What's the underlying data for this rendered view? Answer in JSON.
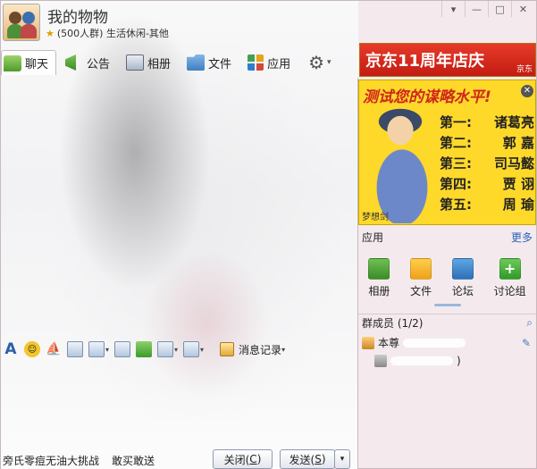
{
  "header": {
    "title": "我的物物",
    "subtitle": "(500人群) 生活休闲-其他"
  },
  "window_controls": {
    "menu": "▾",
    "minimize": "—",
    "maximize": "□",
    "close": "✕"
  },
  "tabs": [
    {
      "label": "聊天",
      "icon": "chat-icon"
    },
    {
      "label": "公告",
      "icon": "notice-icon"
    },
    {
      "label": "相册",
      "icon": "album-icon"
    },
    {
      "label": "文件",
      "icon": "file-icon"
    },
    {
      "label": "应用",
      "icon": "app-icon"
    }
  ],
  "ads": {
    "banner": "京东11周年店庆",
    "banner_brand": "京东",
    "headline": "测试您的谋略水平!",
    "rows": [
      {
        "rank": "第一:",
        "name": "诸葛亮"
      },
      {
        "rank": "第二:",
        "name": "郭  嘉"
      },
      {
        "rank": "第三:",
        "name": "司马懿"
      },
      {
        "rank": "第四:",
        "name": "贾  诩"
      },
      {
        "rank": "第五:",
        "name": "周  瑜"
      }
    ],
    "stamp": "梦想剑"
  },
  "apps": {
    "title": "应用",
    "more": "更多",
    "items": [
      "相册",
      "文件",
      "论坛",
      "讨论组"
    ]
  },
  "members": {
    "title": "群成员 (1/2)",
    "list": [
      "本尊",
      ")"
    ]
  },
  "input_toolbar": {
    "history": "消息记录"
  },
  "bottom": {
    "promo1": "旁氏零痘无油大挑战",
    "promo2": "敢买敢送",
    "close_label": "关闭(",
    "close_key": "C",
    "send_label": "发送(",
    "send_key": "S"
  },
  "colors": {
    "accent": "#2a63b8",
    "ad_red": "#d0261b",
    "ad_yellow": "#ffd92a"
  }
}
